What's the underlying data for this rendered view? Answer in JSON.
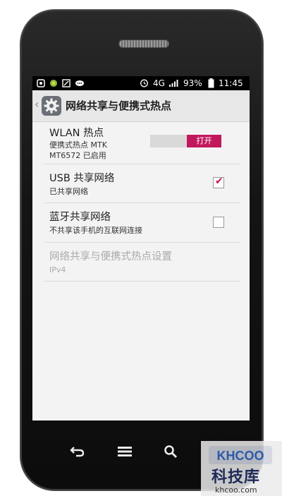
{
  "status_bar": {
    "network": "4G",
    "battery_percent": "93%",
    "time": "11:45",
    "left_icons": [
      "android-settings-icon",
      "coin-icon",
      "notification-icon",
      "chat-icon"
    ],
    "right_icons": [
      "alarm-icon",
      "signal-icon",
      "battery-icon"
    ]
  },
  "title_bar": {
    "title": "网络共享与便携式热点"
  },
  "items": {
    "wlan": {
      "title": "WLAN 热点",
      "subtitle_line1": "便携式热点 MTK",
      "subtitle_line2": "MT6572 已启用",
      "toggle_label": "打开",
      "toggle_on": true
    },
    "usb": {
      "title": "USB 共享网络",
      "subtitle": "已共享网络",
      "checked": true
    },
    "bluetooth": {
      "title": "蓝牙共享网络",
      "subtitle": "不共享该手机的互联网连接",
      "checked": false
    },
    "hotspot_settings": {
      "title": "网络共享与便携式热点设置",
      "subtitle": "IPv4",
      "enabled": false
    }
  },
  "nav_keys": [
    "back-icon",
    "menu-icon",
    "search-icon"
  ],
  "watermark": {
    "logo_text": "KHCOO",
    "brand": "科技库",
    "domain": "khcoo.com"
  },
  "colors": {
    "accent": "#c2185b",
    "screen_bg": "#f3f3f3",
    "titlebar_bg": "#e7e7e7"
  }
}
